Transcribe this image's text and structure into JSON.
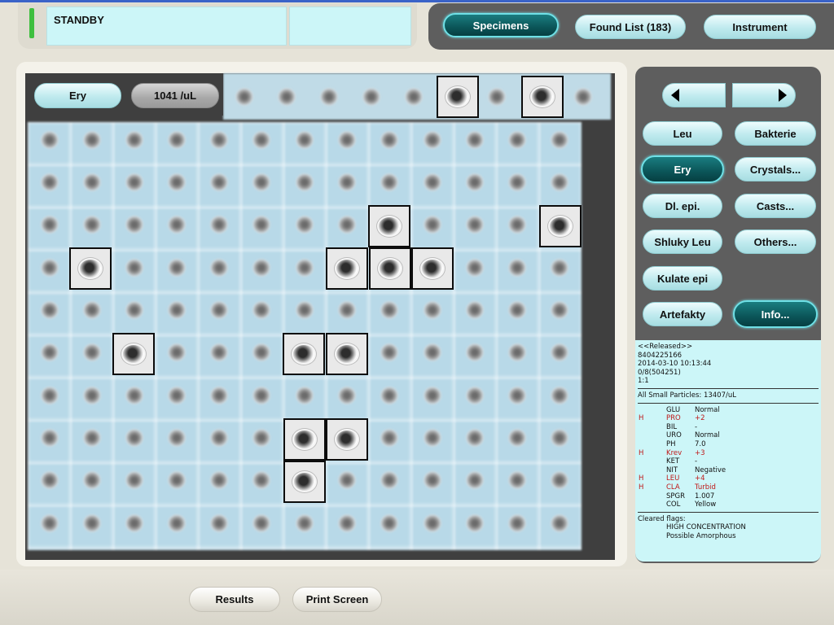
{
  "status": {
    "text": "STANDBY",
    "led_color": "#3fbf3f"
  },
  "nav": {
    "specimens": "Specimens",
    "found_list": "Found List (183)",
    "instrument": "Instrument"
  },
  "grid": {
    "category": "Ery",
    "count": "1041 /uL"
  },
  "categories": {
    "leu": "Leu",
    "bakterie": "Bakterie",
    "ery": "Ery",
    "crystals": "Crystals...",
    "dl_epi": "Dl. epi.",
    "casts": "Casts...",
    "shluky_leu": "Shluky Leu",
    "others": "Others...",
    "kulate_epi": "Kulate epi",
    "artefakty": "Artefakty",
    "info": "Info..."
  },
  "info": {
    "released": "<<Released>>",
    "sample_id": "8404225166",
    "datetime": "2014-03-10 10:13:44",
    "rack": "0/8(504251)",
    "dilution": "1:1",
    "small_particles": "All Small Particles: 13407/uL",
    "urinalysis": [
      {
        "flag": "",
        "name": "GLU",
        "value": "Normal"
      },
      {
        "flag": "H",
        "name": "PRO",
        "value": "+2"
      },
      {
        "flag": "",
        "name": "BIL",
        "value": "-"
      },
      {
        "flag": "",
        "name": "URO",
        "value": "Normal"
      },
      {
        "flag": "",
        "name": "PH",
        "value": "7.0"
      },
      {
        "flag": "H",
        "name": "Krev",
        "value": "+3"
      },
      {
        "flag": "",
        "name": "KET",
        "value": "-"
      },
      {
        "flag": "",
        "name": "NIT",
        "value": "Negative"
      },
      {
        "flag": "H",
        "name": "LEU",
        "value": "+4"
      },
      {
        "flag": "H",
        "name": "CLA",
        "value": "Turbid"
      },
      {
        "flag": "",
        "name": "SPGR",
        "value": "1.007"
      },
      {
        "flag": "",
        "name": "COL",
        "value": "Yellow"
      }
    ],
    "cleared_flags_label": "Cleared flags:",
    "cleared_flags": [
      "HIGH CONCENTRATION",
      "Possible Amorphous"
    ]
  },
  "bottom": {
    "results": "Results",
    "print_screen": "Print Screen"
  }
}
